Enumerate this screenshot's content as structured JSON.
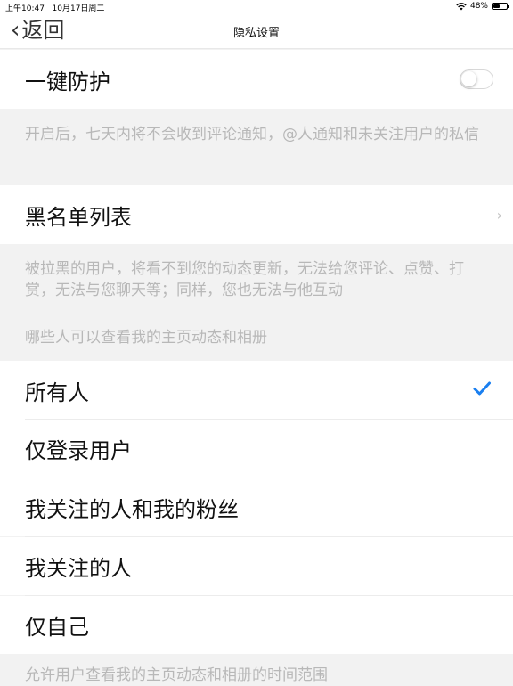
{
  "status_bar": {
    "time": "上午10:47",
    "date": "10月17日周二",
    "battery": "48%",
    "battery_level": 0.48
  },
  "nav": {
    "back_label": "返回",
    "title": "隐私设置"
  },
  "protection": {
    "label": "一键防护",
    "enabled": false,
    "description": "开启后，七天内将不会收到评论通知，@人通知和未关注用户的私信"
  },
  "blacklist": {
    "label": "黑名单列表",
    "description": "被拉黑的用户，将看不到您的动态更新，无法给您评论、点赞、打赏，无法与您聊天等；同样，您也无法与他互动"
  },
  "visibility": {
    "header": "哪些人可以查看我的主页动态和相册",
    "options": [
      {
        "label": "所有人",
        "selected": true
      },
      {
        "label": "仅登录用户",
        "selected": false
      },
      {
        "label": "我关注的人和我的粉丝",
        "selected": false
      },
      {
        "label": "我关注的人",
        "selected": false
      },
      {
        "label": "仅自己",
        "selected": false
      }
    ]
  },
  "time_range": {
    "header": "允许用户查看我的主页动态和相册的时间范围"
  },
  "colors": {
    "accent": "#1a7ff0",
    "background": "#f2f2f2"
  }
}
